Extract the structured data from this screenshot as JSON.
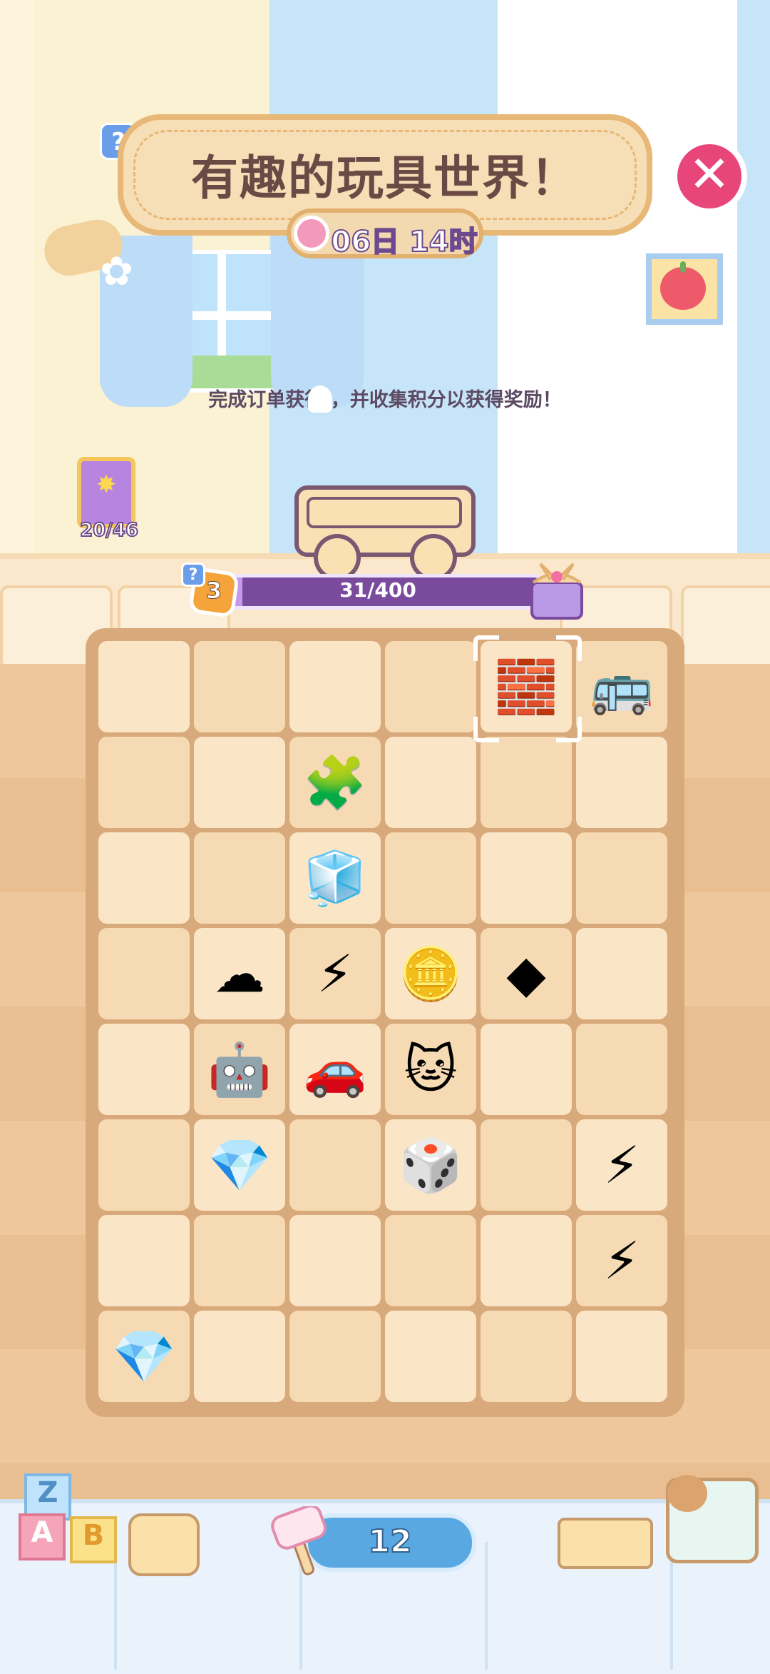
{
  "header": {
    "title": "有趣的玩具世界！",
    "timer": "06日 14时",
    "help": "?",
    "close_symbol": "✕"
  },
  "hint": "完成订单获得 ，并收集积分以获得奖励！",
  "album": {
    "count": "20/46"
  },
  "progress": {
    "level": "3",
    "text": "31/400",
    "fraction": 0.0775,
    "help": "?"
  },
  "board": {
    "rows": 8,
    "cols": 6,
    "items": [
      {
        "row": 0,
        "col": 4,
        "icon": "toy-bricks-in-pink-cloud-icon",
        "glyph": "🧱",
        "selected": true
      },
      {
        "row": 0,
        "col": 5,
        "icon": "toy-bus-icon",
        "glyph": "🚌"
      },
      {
        "row": 1,
        "col": 2,
        "icon": "stacked-blocks-icon",
        "glyph": "🧩"
      },
      {
        "row": 2,
        "col": 2,
        "icon": "toy-cubes-icon",
        "glyph": "🧊"
      },
      {
        "row": 3,
        "col": 1,
        "icon": "toy-in-pink-cloud-icon",
        "glyph": "☁"
      },
      {
        "row": 3,
        "col": 2,
        "icon": "energy-coin-icon",
        "glyph": "⚡"
      },
      {
        "row": 3,
        "col": 3,
        "icon": "purple-coin-stack-icon",
        "glyph": "🪙"
      },
      {
        "row": 3,
        "col": 4,
        "icon": "small-pink-gem-icon",
        "glyph": "◆"
      },
      {
        "row": 4,
        "col": 1,
        "icon": "toy-robot-icon",
        "glyph": "🤖"
      },
      {
        "row": 4,
        "col": 2,
        "icon": "toy-car-icon",
        "glyph": "🚗"
      },
      {
        "row": 4,
        "col": 3,
        "icon": "kitty-coin-icon",
        "glyph": "🐱"
      },
      {
        "row": 5,
        "col": 1,
        "icon": "pink-gem-pile-icon",
        "glyph": "💎"
      },
      {
        "row": 5,
        "col": 3,
        "icon": "shape-sorter-box-icon",
        "glyph": "🎲"
      },
      {
        "row": 5,
        "col": 5,
        "icon": "lightning-bundle-large-icon",
        "glyph": "⚡"
      },
      {
        "row": 6,
        "col": 5,
        "icon": "lightning-bundle-icon",
        "glyph": "⚡"
      },
      {
        "row": 7,
        "col": 0,
        "icon": "pink-gem-icon",
        "glyph": "💎"
      }
    ]
  },
  "bottom": {
    "energy": "12"
  },
  "colors": {
    "accent": "#e8467a",
    "progress": "#7a4b9c",
    "board": "#d8a97a",
    "cell": "#fae6c6"
  }
}
